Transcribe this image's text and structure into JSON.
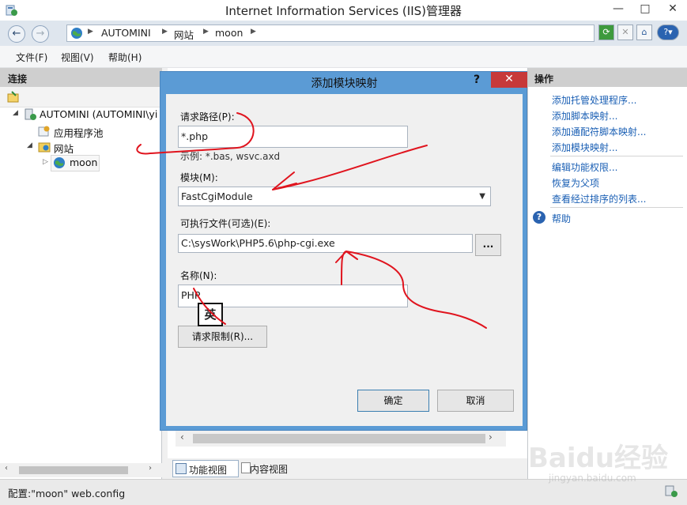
{
  "window": {
    "title": "Internet Information Services (IIS)管理器",
    "min": "—",
    "max": "□",
    "close": "✕"
  },
  "address": {
    "crumbs": [
      "AUTOMINI",
      "网站",
      "moon"
    ]
  },
  "menu": [
    "文件(F)",
    "视图(V)",
    "帮助(H)"
  ],
  "connections": {
    "header": "连接",
    "tree": [
      {
        "label": "AUTOMINI (AUTOMINI\\yi",
        "icon": "server-icon"
      },
      {
        "label": "应用程序池",
        "icon": "app-pool-icon"
      },
      {
        "label": "网站",
        "icon": "sites-folder-icon"
      },
      {
        "label": "moon",
        "icon": "globe-icon"
      }
    ]
  },
  "actions": {
    "header": "操作",
    "group1": [
      "添加托管处理程序...",
      "添加脚本映射...",
      "添加通配符脚本映射...",
      "添加模块映射..."
    ],
    "group2": [
      "编辑功能权限...",
      "恢复为父项",
      "查看经过排序的列表..."
    ],
    "help": "帮助"
  },
  "view_tabs": {
    "features": "功能视图",
    "content": "内容视图"
  },
  "status": "配置:\"moon\" web.config",
  "dialog": {
    "title": "添加模块映射",
    "help": "?",
    "close": "✕",
    "request_path_label": "请求路径(P):",
    "request_path_value": "*.php",
    "example": "示例: *.bas, wsvc.axd",
    "module_label": "模块(M):",
    "module_value": "FastCgiModule",
    "executable_label": "可执行文件(可选)(E):",
    "executable_value": "C:\\sysWork\\PHP5.6\\php-cgi.exe",
    "browse": "...",
    "name_label": "名称(N):",
    "name_value": "PHP",
    "request_restrictions": "请求限制(R)...",
    "ok": "确定",
    "cancel": "取消"
  },
  "ime": "英",
  "watermark": {
    "main": "Baidu经验",
    "sub": "jingyan.baidu.com"
  },
  "colors": {
    "dialog_frame": "#5b9bd5",
    "close_red": "#c7393a",
    "link_blue": "#1a5fb4",
    "annotation_red": "#e0141e"
  }
}
